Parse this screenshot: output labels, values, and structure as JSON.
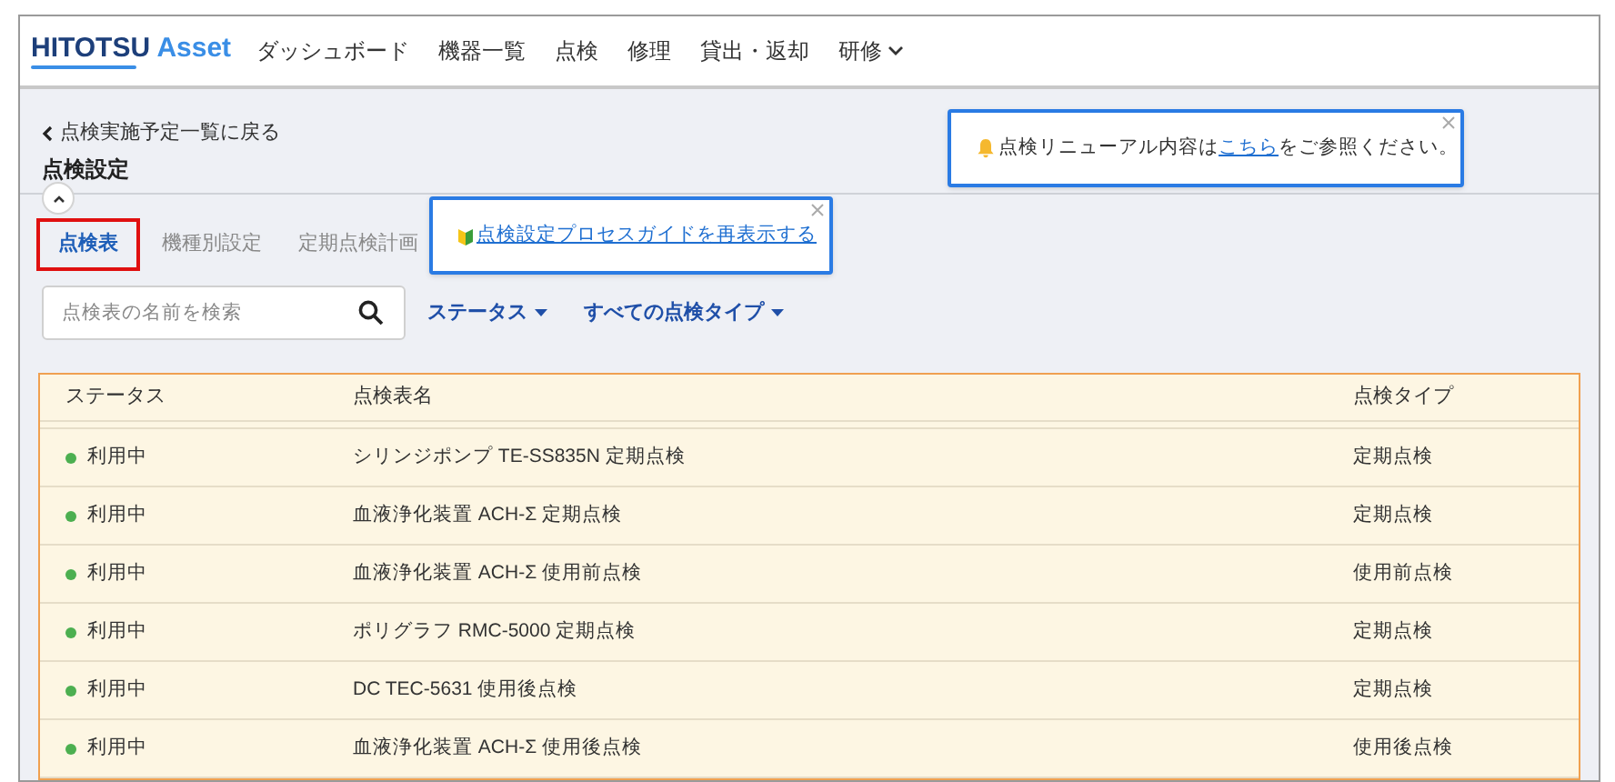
{
  "header": {
    "logo": "HITOTSU Asset",
    "nav": [
      {
        "label": "ダッシュボード",
        "dropdown": false
      },
      {
        "label": "機器一覧",
        "dropdown": false
      },
      {
        "label": "点検",
        "dropdown": false
      },
      {
        "label": "修理",
        "dropdown": false
      },
      {
        "label": "貸出・返却",
        "dropdown": false
      },
      {
        "label": "研修",
        "dropdown": true
      }
    ]
  },
  "back_link": "点検実施予定一覧に戻る",
  "page_title": "点検設定",
  "notice": {
    "text": "点検リニューアル内容は**こちら**をご参照ください。"
  },
  "tabs": [
    {
      "label": "点検表",
      "selected": true
    },
    {
      "label": "機種別設定",
      "selected": false
    },
    {
      "label": "定期点検計画",
      "selected": false
    }
  ],
  "guide_popup": {
    "link": "点検設定プロセスガイドを再表示する"
  },
  "search": {
    "placeholder": "点検表の名前を検索"
  },
  "filters": [
    "ステータス",
    "すべての点検タイプ"
  ],
  "table": {
    "columns": [
      "ステータス",
      "点検表名",
      "点検タイプ"
    ],
    "rows": [
      {
        "status": "利用中",
        "color": "#4caf50",
        "name": "シリンジポンプ TE-SS835N 定期点検",
        "type": "定期点検"
      },
      {
        "status": "利用中",
        "color": "#4caf50",
        "name": "血液浄化装置 ACH-Σ 定期点検",
        "type": "定期点検"
      },
      {
        "status": "利用中",
        "color": "#4caf50",
        "name": "血液浄化装置 ACH-Σ 使用前点検",
        "type": "使用前点検"
      },
      {
        "status": "利用中",
        "color": "#4caf50",
        "name": "ポリグラフ RMC-5000 定期点検",
        "type": "定期点検"
      },
      {
        "status": "利用中",
        "color": "#4caf50",
        "name": "DC TEC-5631 使用後点検",
        "type": "定期点検"
      },
      {
        "status": "利用中",
        "color": "#4caf50",
        "name": "血液浄化装置 ACH-Σ 使用後点検",
        "type": "使用後点検"
      }
    ]
  }
}
